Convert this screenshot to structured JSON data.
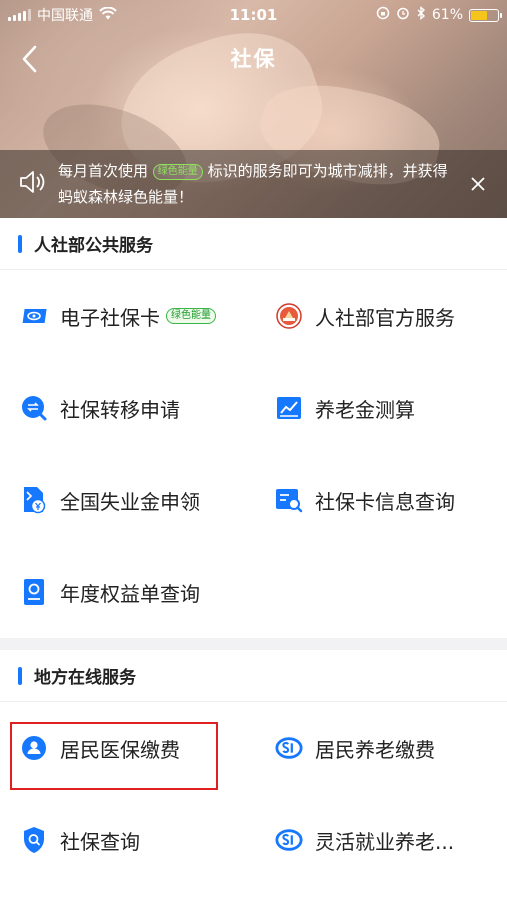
{
  "status": {
    "carrier": "中国联通",
    "time": "11:01",
    "battery": "61%",
    "battery_level": 0.61
  },
  "nav": {
    "title": "社保"
  },
  "notice": {
    "text_before": "每月首次使用",
    "tag": "绿色能量",
    "text_after": "标识的服务即可为城市减排，并获得蚂蚁森林绿色能量！"
  },
  "colors": {
    "accent": "#1677ff",
    "highlight": "#e02020",
    "green": "#39b54a"
  },
  "public_section": {
    "title": "人社部公共服务",
    "items": [
      {
        "label": "电子社保卡",
        "icon": "social-security-card-icon",
        "tag": "绿色能量"
      },
      {
        "label": "人社部官方服务",
        "icon": "ministry-emblem-icon"
      },
      {
        "label": "社保转移申请",
        "icon": "transfer-icon"
      },
      {
        "label": "养老金测算",
        "icon": "chart-icon"
      },
      {
        "label": "全国失业金申领",
        "icon": "yuan-document-icon"
      },
      {
        "label": "社保卡信息查询",
        "icon": "card-search-icon"
      },
      {
        "label": "年度权益单查询",
        "icon": "certificate-icon"
      }
    ]
  },
  "local_section": {
    "title": "地方在线服务",
    "items": [
      {
        "label": "居民医保缴费",
        "icon": "person-icon"
      },
      {
        "label": "居民养老缴费",
        "icon": "si-logo-icon"
      },
      {
        "label": "社保查询",
        "icon": "shield-search-icon"
      },
      {
        "label": "灵活就业养老...",
        "icon": "si-logo-icon"
      }
    ]
  }
}
